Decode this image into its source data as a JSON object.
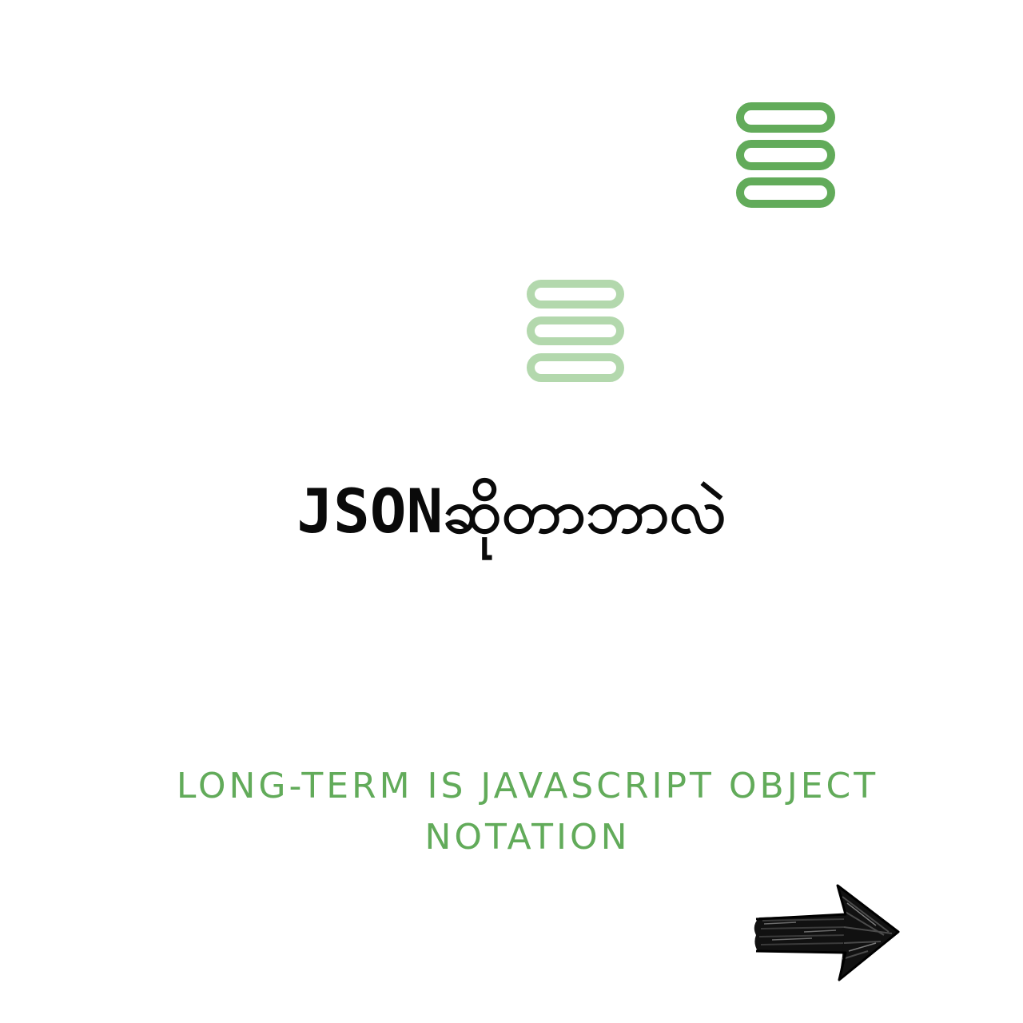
{
  "title": "JSONဆိုတာဘာလဲ",
  "subtitle": "LONG-TERM IS JAVASCRIPT OBJECT NOTATION",
  "icons": {
    "top_stack": "stacked-lines-icon",
    "middle_stack": "stacked-lines-icon",
    "next": "arrow-right-icon"
  },
  "colors": {
    "accent": "#62ab5a",
    "accent_light": "#b3d8ad",
    "text": "#0a0a0a"
  }
}
